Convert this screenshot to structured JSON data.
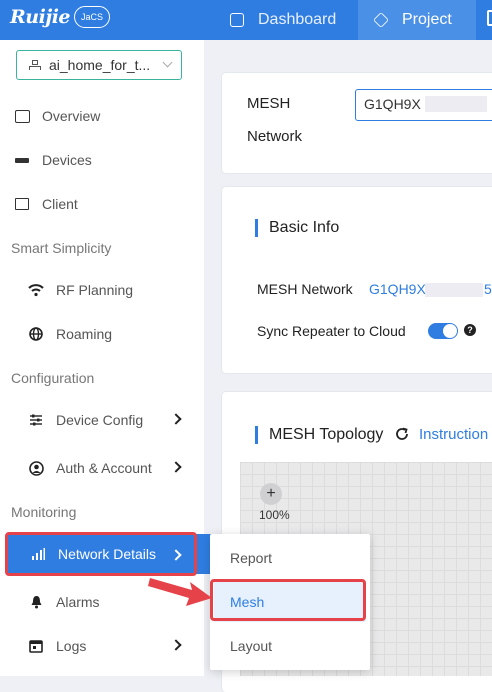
{
  "header": {
    "logo_text": "Ruijie",
    "logo_badge": "JaCS",
    "tabs": [
      {
        "label": "Dashboard",
        "icon": "dashboard-icon"
      },
      {
        "label": "Project",
        "icon": "cube-icon",
        "active": true
      }
    ],
    "brand_color": "#2f7de1"
  },
  "sidebar": {
    "project_select": {
      "value": "ai_home_for_t..."
    },
    "items": [
      {
        "label": "Overview",
        "icon": "overview-icon"
      },
      {
        "label": "Devices",
        "icon": "devices-icon"
      },
      {
        "label": "Client",
        "icon": "client-icon"
      }
    ],
    "sections": {
      "smart": "Smart Simplicity",
      "config": "Configuration",
      "monitor": "Monitoring"
    },
    "smart_items": [
      {
        "label": "RF Planning",
        "icon": "wifi-icon"
      },
      {
        "label": "Roaming",
        "icon": "globe-icon"
      }
    ],
    "config_items": [
      {
        "label": "Device Config",
        "icon": "sliders-icon"
      },
      {
        "label": "Auth & Account",
        "icon": "user-circle-icon"
      }
    ],
    "monitor_items": [
      {
        "label": "Network Details",
        "icon": "bar-chart-icon",
        "selected": true
      },
      {
        "label": "Alarms",
        "icon": "bell-icon"
      },
      {
        "label": "Logs",
        "icon": "calendar-icon"
      }
    ]
  },
  "main": {
    "mesh_network_label_1": "MESH",
    "mesh_network_label_2": "Network",
    "mesh_network_value": "G1QH9X",
    "basic_info": {
      "title": "Basic Info",
      "mesh_network_label": "MESH Network",
      "mesh_network_value": "G1QH9XV",
      "mesh_network_tail": "5",
      "sync_label": "Sync Repeater to Cloud",
      "sync_enabled": true
    },
    "topology": {
      "title": "MESH Topology",
      "instruction_link": "Instruction",
      "zoom_in": "+",
      "zoom_level": "100%"
    }
  },
  "submenu": {
    "items": [
      "Report",
      "Mesh",
      "Layout"
    ],
    "highlighted": "Mesh"
  },
  "annotation_color": "#e5424a"
}
